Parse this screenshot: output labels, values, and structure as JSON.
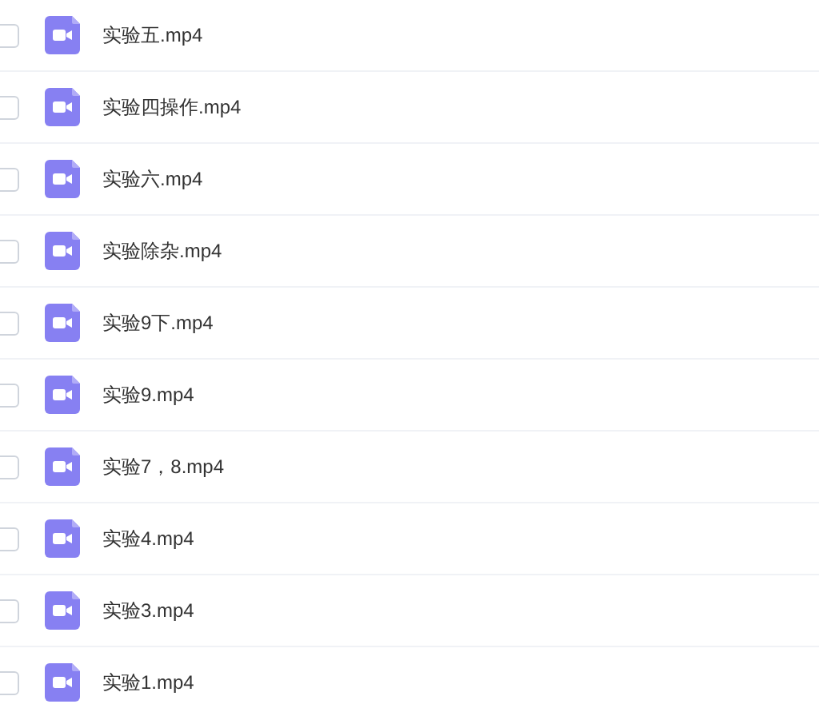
{
  "files": [
    {
      "name": "实验五.mp4",
      "checked": false
    },
    {
      "name": "实验四操作.mp4",
      "checked": false
    },
    {
      "name": "实验六.mp4",
      "checked": false
    },
    {
      "name": "实验除杂.mp4",
      "checked": false
    },
    {
      "name": "实验9下.mp4",
      "checked": false
    },
    {
      "name": "实验9.mp4",
      "checked": false
    },
    {
      "name": "实验7，8.mp4",
      "checked": false
    },
    {
      "name": "实验4.mp4",
      "checked": false
    },
    {
      "name": "实验3.mp4",
      "checked": false
    },
    {
      "name": "实验1.mp4",
      "checked": false
    }
  ]
}
